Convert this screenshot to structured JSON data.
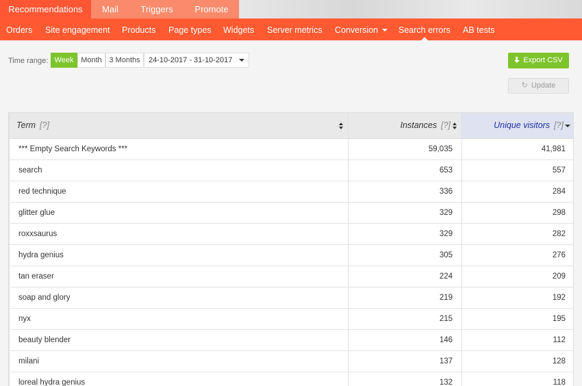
{
  "top_tabs": [
    "Recommendations",
    "Mail",
    "Triggers",
    "Promote"
  ],
  "nav": {
    "items": [
      "Orders",
      "Site engagement",
      "Products",
      "Page types",
      "Widgets",
      "Server metrics",
      "Conversion",
      "Search errors",
      "AB tests"
    ],
    "selected": "Search errors"
  },
  "controls": {
    "time_range_label": "Time range:",
    "ranges": [
      "Week",
      "Month",
      "3 Months"
    ],
    "selected_range": "Week",
    "date_range": "24-10-2017 - 31-10-2017",
    "export_label": "Export CSV",
    "update_label": "Update"
  },
  "table": {
    "columns": [
      {
        "label": "Term",
        "hint": "[?]"
      },
      {
        "label": "Instances",
        "hint": "[?]"
      },
      {
        "label": "Unique visitors",
        "hint": "[?]"
      }
    ],
    "rows": [
      [
        "*** Empty Search Keywords ***",
        "59,035",
        "41,981"
      ],
      [
        "search",
        "653",
        "557"
      ],
      [
        "red technique",
        "336",
        "284"
      ],
      [
        "glitter glue",
        "329",
        "298"
      ],
      [
        "roxxsaurus",
        "329",
        "282"
      ],
      [
        "hydra genius",
        "305",
        "276"
      ],
      [
        "tan eraser",
        "224",
        "209"
      ],
      [
        "soap and glory",
        "219",
        "192"
      ],
      [
        "nyx",
        "215",
        "195"
      ],
      [
        "beauty blender",
        "146",
        "112"
      ],
      [
        "milani",
        "137",
        "128"
      ],
      [
        "loreal hydra genius",
        "132",
        "118"
      ]
    ]
  },
  "colors": {
    "accent": "#ff5a32",
    "green": "#7dc42b",
    "sorted_header": "#1e2ea8"
  }
}
